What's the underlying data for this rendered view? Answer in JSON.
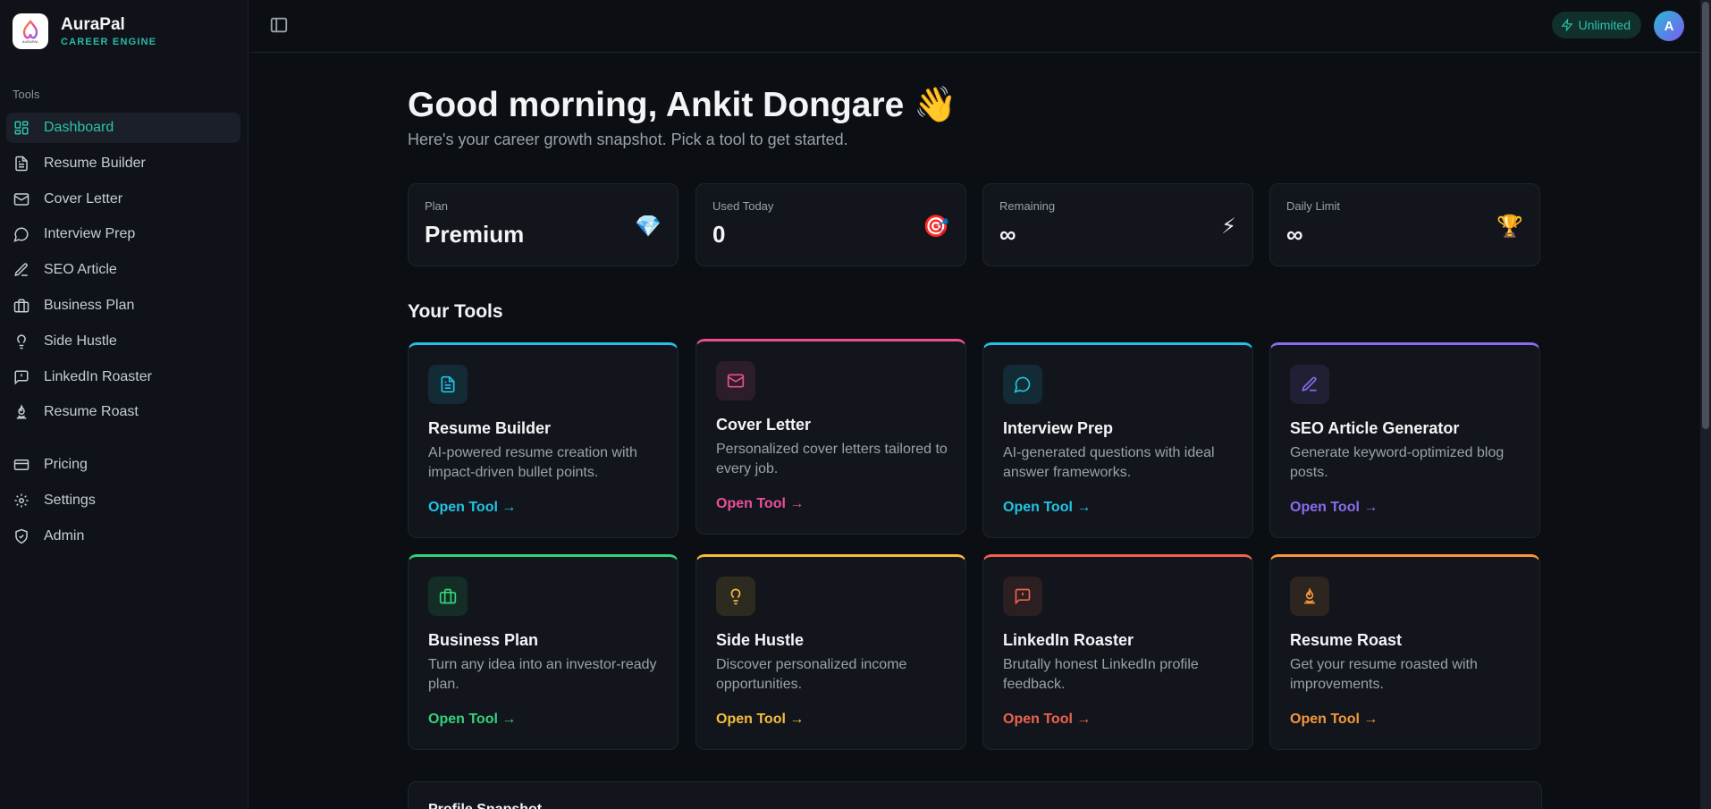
{
  "brand": {
    "name": "AuraPal",
    "subtitle": "CAREER ENGINE",
    "logo_text": "AURAPAL"
  },
  "sidebar": {
    "section_label": "Tools",
    "items": [
      {
        "label": "Dashboard",
        "icon": "dashboard-icon",
        "active": true
      },
      {
        "label": "Resume Builder",
        "icon": "file-text-icon"
      },
      {
        "label": "Cover Letter",
        "icon": "mail-icon"
      },
      {
        "label": "Interview Prep",
        "icon": "message-circle-icon"
      },
      {
        "label": "SEO Article",
        "icon": "pen-icon"
      },
      {
        "label": "Business Plan",
        "icon": "briefcase-icon"
      },
      {
        "label": "Side Hustle",
        "icon": "lightbulb-icon"
      },
      {
        "label": "LinkedIn Roaster",
        "icon": "message-alert-icon"
      },
      {
        "label": "Resume Roast",
        "icon": "flame-icon"
      }
    ],
    "bottom_items": [
      {
        "label": "Pricing",
        "icon": "credit-card-icon"
      },
      {
        "label": "Settings",
        "icon": "gear-icon"
      },
      {
        "label": "Admin",
        "icon": "shield-check-icon"
      }
    ]
  },
  "topbar": {
    "plan_badge": "Unlimited",
    "avatar_initial": "A"
  },
  "main": {
    "greeting": "Good morning, Ankit Dongare",
    "greeting_emoji": "👋",
    "subtitle": "Here's your career growth snapshot. Pick a tool to get started.",
    "stats": [
      {
        "label": "Plan",
        "value": "Premium",
        "icon": "💎"
      },
      {
        "label": "Used Today",
        "value": "0",
        "icon": "🎯"
      },
      {
        "label": "Remaining",
        "value": "∞",
        "icon": "⚡"
      },
      {
        "label": "Daily Limit",
        "value": "∞",
        "icon": "🏆"
      }
    ],
    "tools_title": "Your Tools",
    "tools": [
      {
        "title": "Resume Builder",
        "desc": "AI-powered resume creation with impact-driven bullet points.",
        "link": "Open Tool →",
        "color": "#22c3e6",
        "icon": "file-text-icon"
      },
      {
        "title": "Cover Letter",
        "desc": "Personalized cover letters tailored to every job.",
        "link": "Open Tool →",
        "color": "#ec4f96",
        "icon": "mail-icon"
      },
      {
        "title": "Interview Prep",
        "desc": "AI-generated questions with ideal answer frameworks.",
        "link": "Open Tool →",
        "color": "#22c3e6",
        "icon": "message-circle-icon"
      },
      {
        "title": "SEO Article Generator",
        "desc": "Generate keyword-optimized blog posts.",
        "link": "Open Tool →",
        "color": "#8b6cf0",
        "icon": "pen-icon"
      },
      {
        "title": "Business Plan",
        "desc": "Turn any idea into an investor-ready plan.",
        "link": "Open Tool →",
        "color": "#34d27c",
        "icon": "briefcase-icon"
      },
      {
        "title": "Side Hustle",
        "desc": "Discover personalized income opportunities.",
        "link": "Open Tool →",
        "color": "#f5bd3c",
        "icon": "lightbulb-icon"
      },
      {
        "title": "LinkedIn Roaster",
        "desc": "Brutally honest LinkedIn profile feedback.",
        "link": "Open Tool →",
        "color": "#f0614e",
        "icon": "message-alert-icon"
      },
      {
        "title": "Resume Roast",
        "desc": "Get your resume roasted with improvements.",
        "link": "Open Tool →",
        "color": "#f5973c",
        "icon": "flame-icon"
      }
    ],
    "profile_title": "Profile Snapshot"
  },
  "colors": {
    "accent": "#2bc3ad",
    "background": "#0b0e13",
    "card": "#12161c"
  }
}
